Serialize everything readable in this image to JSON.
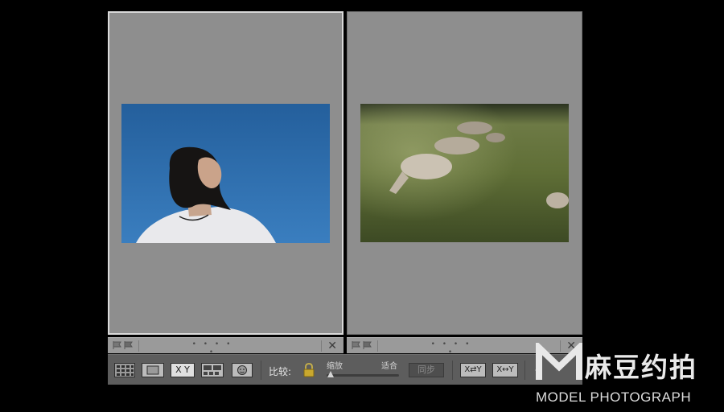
{
  "compare": {
    "left_photo": {
      "subject": "woman-under-blue-sky"
    },
    "right_photo": {
      "subject": "sheep-on-grass"
    },
    "strip_dots": "• • • • •",
    "close_glyph": "✕"
  },
  "toolbar": {
    "xy_label": "X Y",
    "compare_label": "比较:",
    "zoom_label": "缩放",
    "fit_label": "适合",
    "sync_label": "同步",
    "swap_label": "X⇄Y",
    "make_select_label": "X↔Y",
    "zoom_level": 0
  },
  "watermark": {
    "logo_letter": "M",
    "title": "麻豆约拍",
    "subtitle": "MODEL PHOTOGRAPH"
  },
  "colors": {
    "pane_bg": "#8e8e8e",
    "toolbar_bg": "#5d5d5d",
    "sky_blue": "#2f6fad",
    "grass_green": "#5b6b34"
  }
}
